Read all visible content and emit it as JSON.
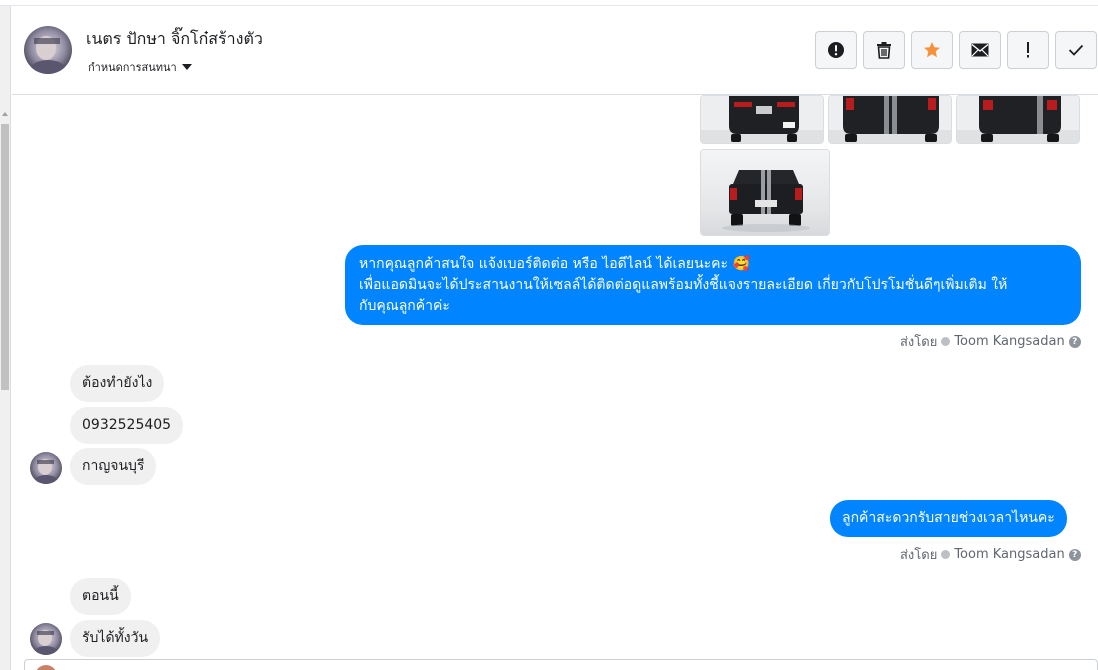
{
  "header": {
    "contact_name": "เนตร ปักษา จิ๊กโก๋สร้างตัว",
    "assign_label": "กำหนดการสนทนา"
  },
  "toolbar": {
    "buttons": [
      {
        "icon": "alert-circle-icon",
        "title": "spam"
      },
      {
        "icon": "trash-icon",
        "title": "delete"
      },
      {
        "icon": "star-icon",
        "title": "star"
      },
      {
        "icon": "mail-icon",
        "title": "mark-unread"
      },
      {
        "icon": "exclamation-icon",
        "title": "follow-up"
      },
      {
        "icon": "check-icon",
        "title": "done"
      }
    ]
  },
  "colors": {
    "outgoing_bubble": "#0084ff",
    "incoming_bubble": "#f1f0f0",
    "star": "#f7923a"
  },
  "messages": {
    "out_1": {
      "lines": [
        "หากคุณลูกค้าสนใจ แจ้งเบอร์ติดต่อ หรือ ไอดีไลน์ ได้เลยนะคะ 🥰",
        "เพื่อแอดมินจะได้ประสานงานให้เซลล์ได้ติดต่อดูแลพร้อมทั้งชี้แจงรายละเอียด เกี่ยวกับโปรโมชั่นดีๆเพิ่มเติม ให้",
        "กับคุณลูกค้าค่ะ"
      ]
    },
    "sent_by_1": {
      "prefix": "ส่งโดย",
      "name": "Toom Kangsadan"
    },
    "in_1": "ต้องทำยังไง",
    "in_2": "0932525405",
    "in_3": "กาญจนบุรี",
    "out_2": "ลูกค้าสะดวกรับสายช่วงเวลาไหนคะ",
    "sent_by_2": {
      "prefix": "ส่งโดย",
      "name": "Toom Kangsadan"
    },
    "in_4": "ตอนนี้",
    "in_5": "รับได้ทั้งวัน"
  }
}
